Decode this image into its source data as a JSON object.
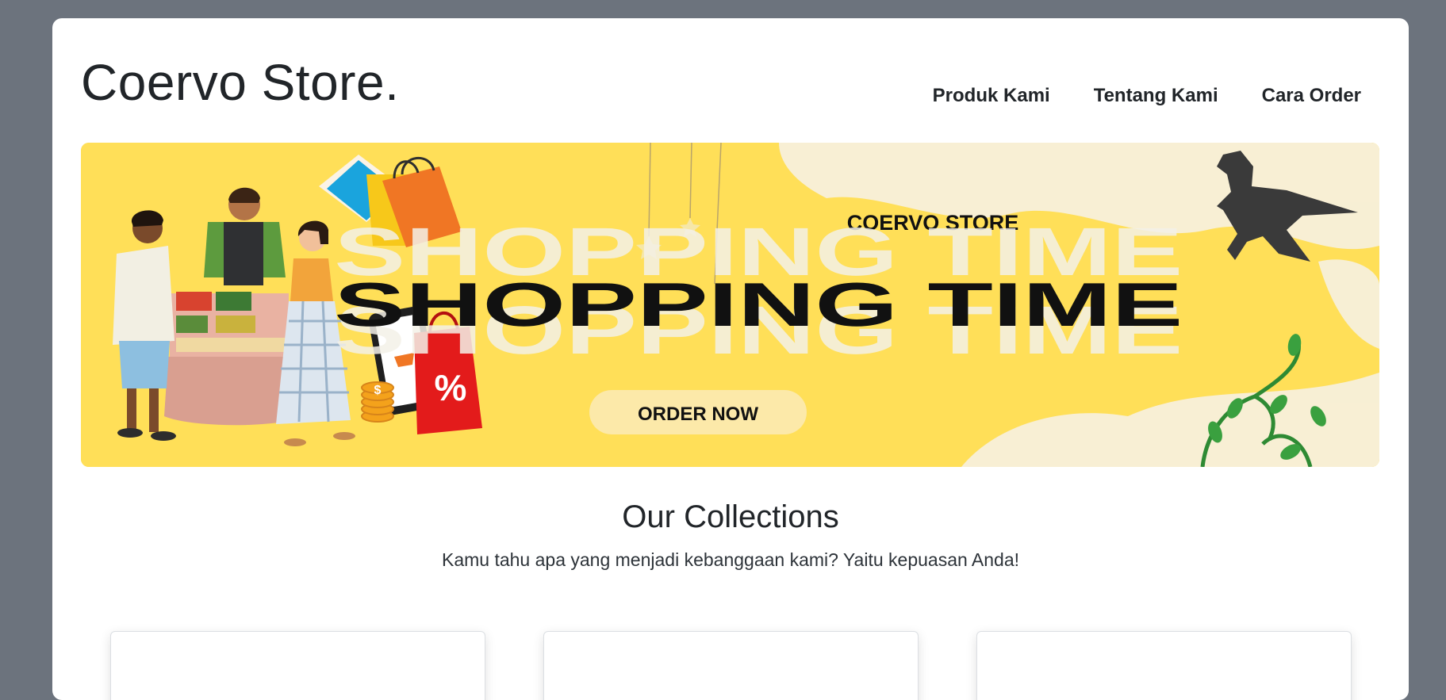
{
  "brand": "Coervo Store.",
  "nav": {
    "items": [
      {
        "label": "Produk Kami"
      },
      {
        "label": "Tentang Kami"
      },
      {
        "label": "Cara Order"
      }
    ]
  },
  "hero": {
    "brand_text": "COERVO STORE",
    "headline": "SHOPPING TIME",
    "cta_label": "ORDER NOW",
    "badge_symbol": "%",
    "coin_symbol": "$",
    "colors": {
      "background": "#ffdf58",
      "cta": "#fce9a9",
      "headline": "#111111"
    }
  },
  "collections": {
    "title": "Our Collections",
    "subtitle": "Kamu tahu apa yang menjadi kebanggaan kami? Yaitu kepuasan Anda!"
  }
}
